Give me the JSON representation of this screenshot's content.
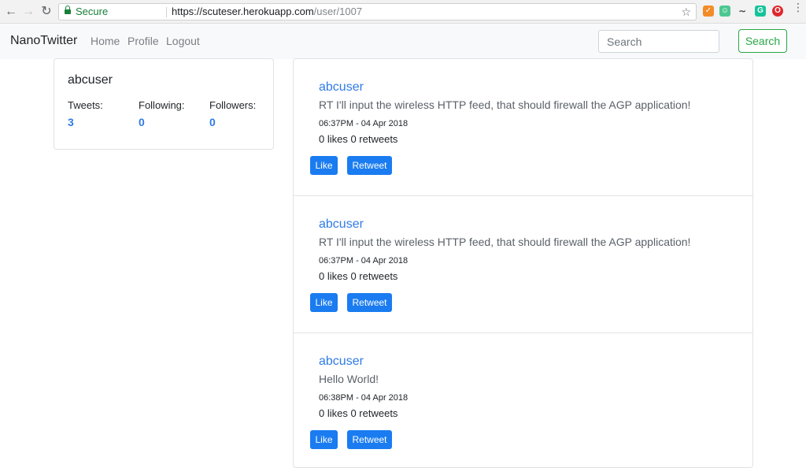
{
  "browser": {
    "secure_label": "Secure",
    "url_host": "https://scuteser.herokuapp.com",
    "url_path": "/user/1007"
  },
  "navbar": {
    "brand": "NanoTwitter",
    "links": [
      "Home",
      "Profile",
      "Logout"
    ],
    "search_placeholder": "Search",
    "search_button": "Search"
  },
  "profile": {
    "username": "abcuser",
    "stats": [
      {
        "label": "Tweets:",
        "value": "3"
      },
      {
        "label": "Following:",
        "value": "0"
      },
      {
        "label": "Followers:",
        "value": "0"
      }
    ]
  },
  "tweets": [
    {
      "user": "abcuser",
      "text": "RT I'll input the wireless HTTP feed, that should firewall the AGP application!",
      "time": "06:37PM - 04 Apr 2018",
      "stats": "0 likes 0 retweets",
      "like_label": "Like",
      "retweet_label": "Retweet"
    },
    {
      "user": "abcuser",
      "text": "RT I'll input the wireless HTTP feed, that should firewall the AGP application!",
      "time": "06:37PM - 04 Apr 2018",
      "stats": "0 likes 0 retweets",
      "like_label": "Like",
      "retweet_label": "Retweet"
    },
    {
      "user": "abcuser",
      "text": "Hello World!",
      "time": "06:38PM - 04 Apr 2018",
      "stats": "0 likes 0 retweets",
      "like_label": "Like",
      "retweet_label": "Retweet"
    }
  ],
  "colors": {
    "link_blue": "#2f7be6",
    "button_blue": "#1a7cf0",
    "search_green": "#28a745",
    "secure_green": "#188038"
  }
}
